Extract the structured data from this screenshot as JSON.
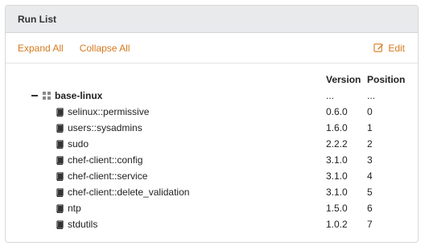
{
  "panel": {
    "title": "Run List"
  },
  "toolbar": {
    "expand_all": "Expand All",
    "collapse_all": "Collapse All",
    "edit": "Edit"
  },
  "table": {
    "headers": {
      "version": "Version",
      "position": "Position"
    },
    "root": {
      "name": "base-linux",
      "version": "...",
      "position": "..."
    },
    "items": [
      {
        "name": "selinux::permissive",
        "version": "0.6.0",
        "position": "0"
      },
      {
        "name": "users::sysadmins",
        "version": "1.6.0",
        "position": "1"
      },
      {
        "name": "sudo",
        "version": "2.2.2",
        "position": "2"
      },
      {
        "name": "chef-client::config",
        "version": "3.1.0",
        "position": "3"
      },
      {
        "name": "chef-client::service",
        "version": "3.1.0",
        "position": "4"
      },
      {
        "name": "chef-client::delete_validation",
        "version": "3.1.0",
        "position": "5"
      },
      {
        "name": "ntp",
        "version": "1.5.0",
        "position": "6"
      },
      {
        "name": "stdutils",
        "version": "1.0.2",
        "position": "7"
      }
    ]
  },
  "colors": {
    "accent": "#d57a1f",
    "header_bg": "#e9eaec"
  }
}
